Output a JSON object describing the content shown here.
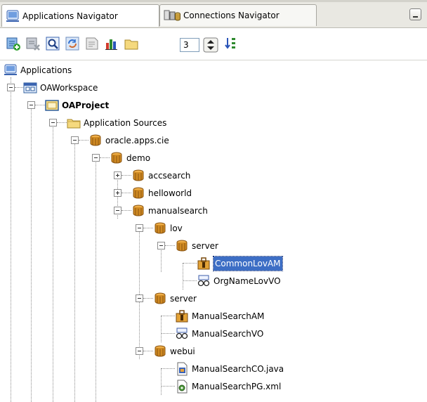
{
  "tabs": [
    {
      "label": "Applications Navigator",
      "active": true
    },
    {
      "label": "Connections Navigator",
      "active": false
    }
  ],
  "toolbar": {
    "buttons": [
      "new-application-icon",
      "remove-icon",
      "find-icon",
      "refresh-icon",
      "edit-icon",
      "chart-icon",
      "folder-icon"
    ],
    "level_value": "3",
    "filter_icon": "sort-icon"
  },
  "tree": [
    {
      "label": "Applications",
      "icon": "applications-icon"
    },
    {
      "label": "OAWorkspace",
      "icon": "workspace-icon"
    },
    {
      "label": "OAProject",
      "icon": "project-icon",
      "bold": true
    },
    {
      "label": "Application Sources",
      "icon": "folder-icon"
    },
    {
      "label": "oracle.apps.cie",
      "icon": "package-icon"
    },
    {
      "label": "demo",
      "icon": "package-icon"
    },
    {
      "label": "accsearch",
      "icon": "package-icon"
    },
    {
      "label": "helloworld",
      "icon": "package-icon"
    },
    {
      "label": "manualsearch",
      "icon": "package-icon"
    },
    {
      "label": "lov",
      "icon": "package-icon"
    },
    {
      "label": "server",
      "icon": "package-icon"
    },
    {
      "label": "CommonLovAM",
      "icon": "application-module-icon",
      "selected": true
    },
    {
      "label": "OrgNameLovVO",
      "icon": "view-object-icon"
    },
    {
      "label": "server",
      "icon": "package-icon"
    },
    {
      "label": "ManualSearchAM",
      "icon": "application-module-icon"
    },
    {
      "label": "ManualSearchVO",
      "icon": "view-object-icon"
    },
    {
      "label": "webui",
      "icon": "package-icon"
    },
    {
      "label": "ManualSearchCO.java",
      "icon": "java-file-icon"
    },
    {
      "label": "ManualSearchPG.xml",
      "icon": "xml-file-icon"
    }
  ],
  "colors": {
    "selection": "#3d6ec5",
    "package": "#c8821e",
    "folder": "#f3d77a"
  }
}
